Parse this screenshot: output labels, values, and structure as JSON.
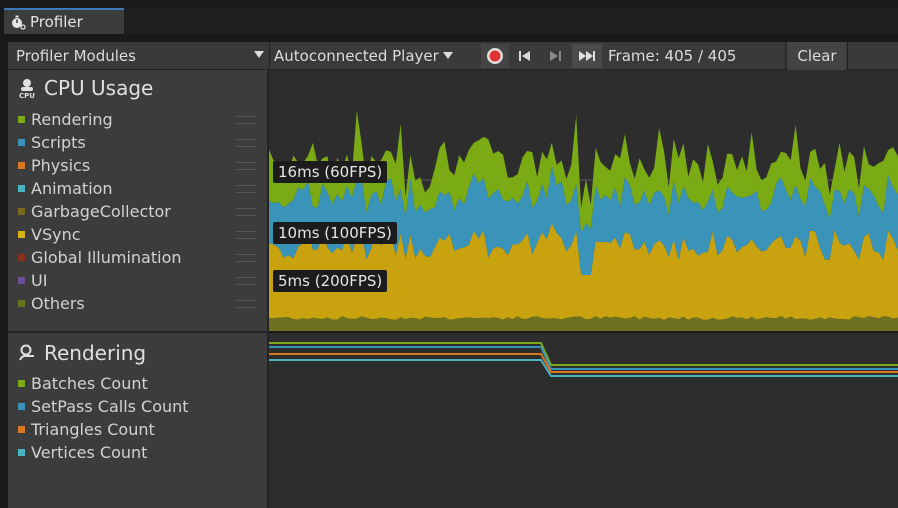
{
  "tab": {
    "title": "Profiler"
  },
  "toolbar": {
    "modules_label": "Profiler Modules",
    "target_label": "Autoconnected Player",
    "frame_label": "Frame: 405 / 405",
    "clear_label": "Clear"
  },
  "cpu_module": {
    "title": "CPU Usage",
    "items": [
      {
        "label": "Rendering",
        "color": "#7aaa14"
      },
      {
        "label": "Scripts",
        "color": "#3a93b9"
      },
      {
        "label": "Physics",
        "color": "#d9781d"
      },
      {
        "label": "Animation",
        "color": "#4ab3c1"
      },
      {
        "label": "GarbageCollector",
        "color": "#7a6b1c"
      },
      {
        "label": "VSync",
        "color": "#d8b113"
      },
      {
        "label": "Global Illumination",
        "color": "#8a2f1d"
      },
      {
        "label": "UI",
        "color": "#6c4e95"
      },
      {
        "label": "Others",
        "color": "#6d7220"
      }
    ],
    "markers": [
      {
        "label": "16ms (60FPS)"
      },
      {
        "label": "10ms (100FPS)"
      },
      {
        "label": "5ms (200FPS)"
      }
    ]
  },
  "rendering_module": {
    "title": "Rendering",
    "items": [
      {
        "label": "Batches Count",
        "color": "#7aaa14"
      },
      {
        "label": "SetPass Calls Count",
        "color": "#3a93b9"
      },
      {
        "label": "Triangles Count",
        "color": "#d9781d"
      },
      {
        "label": "Vertices Count",
        "color": "#4ab3c1"
      }
    ]
  }
}
